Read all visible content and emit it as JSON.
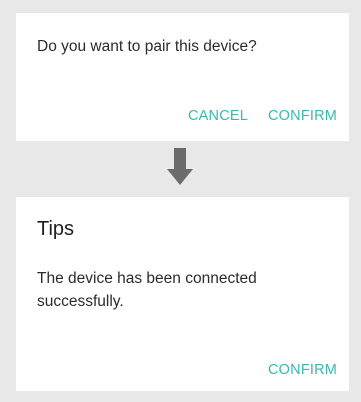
{
  "pair_dialog": {
    "message": "Do you want to pair this device?",
    "cancel_label": "CANCEL",
    "confirm_label": "CONFIRM"
  },
  "tips_dialog": {
    "title": "Tips",
    "message": "The device has been connected successfully.",
    "confirm_label": "CONFIRM"
  },
  "icons": {
    "arrow": "arrow-down-icon"
  },
  "colors": {
    "background": "#e8e8e8",
    "dialog": "#ffffff",
    "accent": "#39b8b0",
    "arrow": "#6b6b6b",
    "text": "#2b2b2b"
  }
}
